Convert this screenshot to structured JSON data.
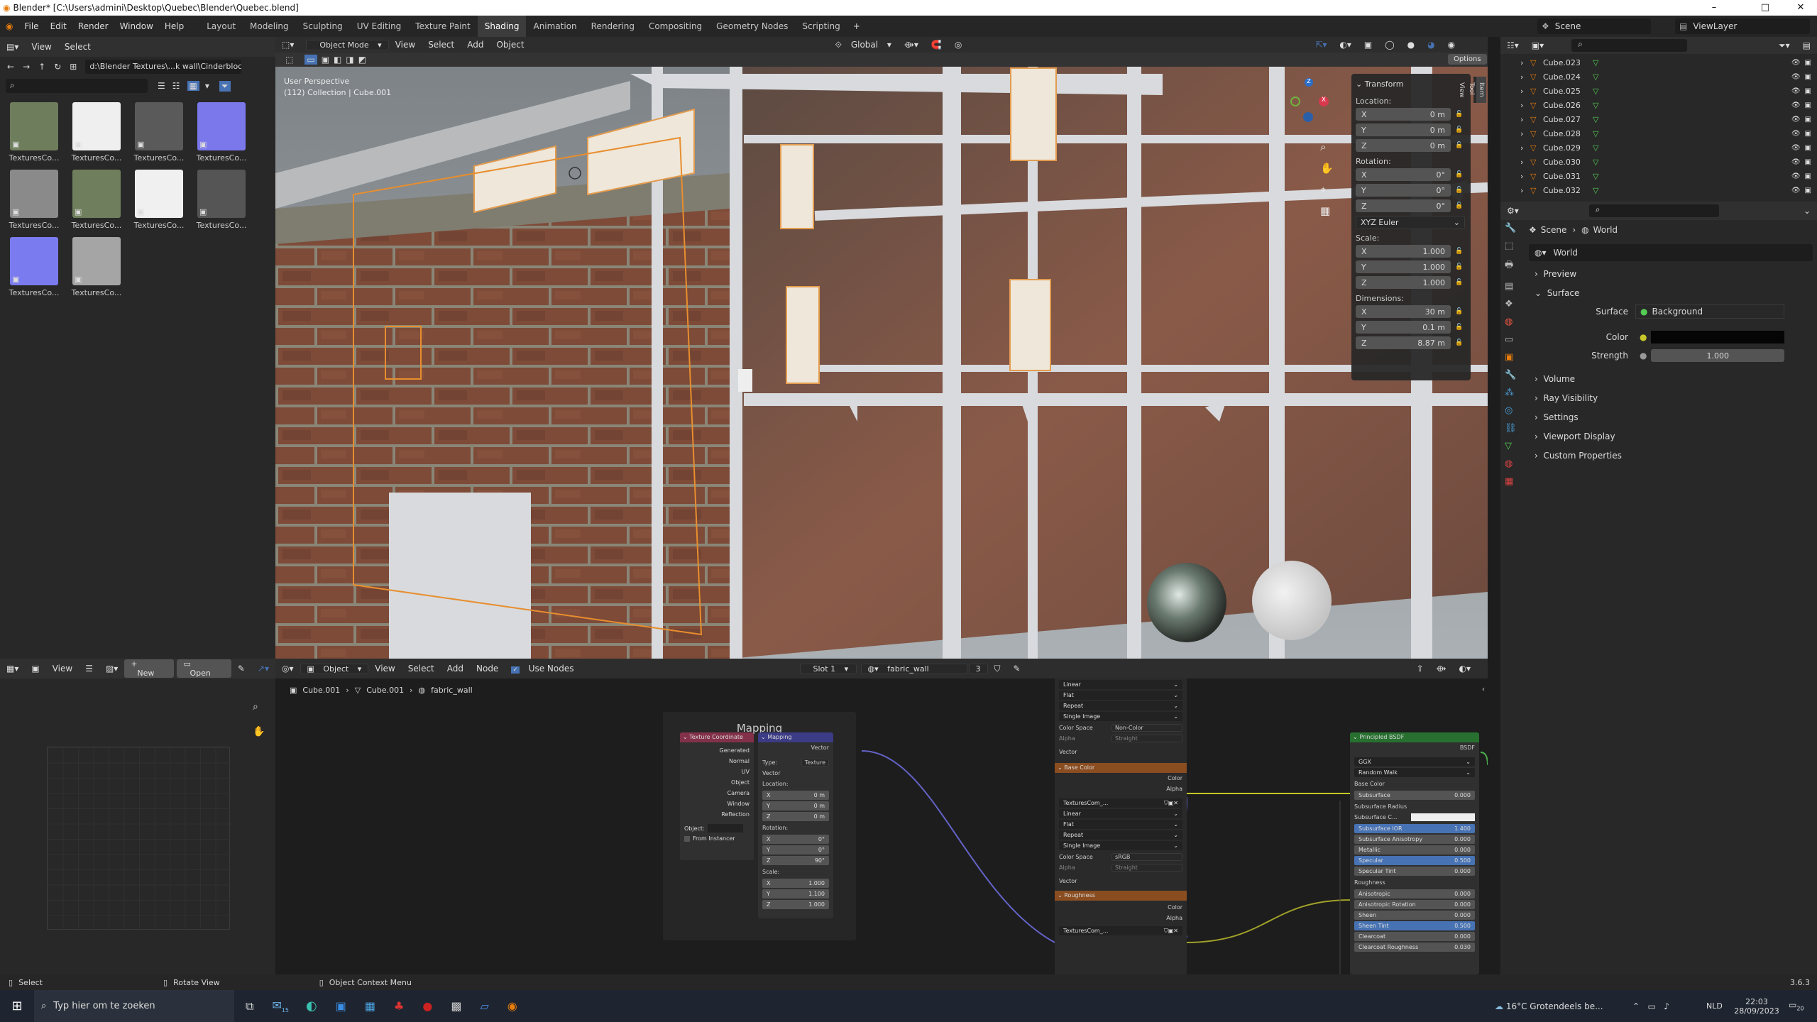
{
  "window": {
    "title": "Blender* [C:\\Users\\admini\\Desktop\\Quebec\\Blender\\Quebec.blend]",
    "minimize": "–",
    "maximize": "□",
    "close": "✕"
  },
  "menu": {
    "file": "File",
    "edit": "Edit",
    "render": "Render",
    "window": "Window",
    "help": "Help"
  },
  "workspaces": [
    "Layout",
    "Modeling",
    "Sculpting",
    "UV Editing",
    "Texture Paint",
    "Shading",
    "Animation",
    "Rendering",
    "Compositing",
    "Geometry Nodes",
    "Scripting"
  ],
  "active_workspace": "Shading",
  "scene": {
    "name": "Scene",
    "viewlayer": "ViewLayer"
  },
  "file_browser": {
    "view": "View",
    "select": "Select",
    "path": "d:\\Blender Textures\\...k wall\\Cinderblocks\\",
    "items": [
      {
        "label": "TexturesCo...",
        "color": "#6e7e5c"
      },
      {
        "label": "TexturesCo...",
        "color": "#efefef"
      },
      {
        "label": "TexturesCo...",
        "color": "#5a5a5a"
      },
      {
        "label": "TexturesCo...",
        "color": "#7b78ec"
      },
      {
        "label": "TexturesCo...",
        "color": "#8a8a8a"
      },
      {
        "label": "TexturesCo...",
        "color": "#6f7f5d"
      },
      {
        "label": "TexturesCo...",
        "color": "#f0f0f0"
      },
      {
        "label": "TexturesCo...",
        "color": "#555555"
      },
      {
        "label": "TexturesCo...",
        "color": "#7a7bee"
      },
      {
        "label": "TexturesCo...",
        "color": "#a5a5a5"
      }
    ]
  },
  "viewport": {
    "mode": "Object Mode",
    "view": "View",
    "select": "Select",
    "add": "Add",
    "object": "Object",
    "orientation": "Global",
    "options": "Options",
    "perspective": "User Perspective",
    "collection": "(112) Collection | Cube.001"
  },
  "transform": {
    "title": "Transform",
    "location_label": "Location:",
    "location": [
      {
        "axis": "X",
        "value": "0 m"
      },
      {
        "axis": "Y",
        "value": "0 m"
      },
      {
        "axis": "Z",
        "value": "0 m"
      }
    ],
    "rotation_label": "Rotation:",
    "rotation": [
      {
        "axis": "X",
        "value": "0°"
      },
      {
        "axis": "Y",
        "value": "0°"
      },
      {
        "axis": "Z",
        "value": "0°"
      }
    ],
    "euler": "XYZ Euler",
    "scale_label": "Scale:",
    "scale": [
      {
        "axis": "X",
        "value": "1.000"
      },
      {
        "axis": "Y",
        "value": "1.000"
      },
      {
        "axis": "Z",
        "value": "1.000"
      }
    ],
    "dimensions_label": "Dimensions:",
    "dimensions": [
      {
        "axis": "X",
        "value": "30 m"
      },
      {
        "axis": "Y",
        "value": "0.1 m"
      },
      {
        "axis": "Z",
        "value": "8.87 m"
      }
    ]
  },
  "side_tabs": [
    "Item",
    "Tool",
    "View"
  ],
  "outliner": {
    "items": [
      "Cube.023",
      "Cube.024",
      "Cube.025",
      "Cube.026",
      "Cube.027",
      "Cube.028",
      "Cube.029",
      "Cube.030",
      "Cube.031",
      "Cube.032"
    ]
  },
  "properties": {
    "breadcrumb_scene": "Scene",
    "breadcrumb_world": "World",
    "world": "World",
    "sections": {
      "preview": "Preview",
      "surface": "Surface",
      "volume": "Volume",
      "ray_visibility": "Ray Visibility",
      "settings": "Settings",
      "viewport_display": "Viewport Display",
      "custom_properties": "Custom Properties"
    },
    "surface_label": "Surface",
    "surface_value": "Background",
    "color_label": "Color",
    "strength_label": "Strength",
    "strength_value": "1.000"
  },
  "image_editor": {
    "view": "View",
    "new": "New",
    "open": "Open"
  },
  "node_editor": {
    "object": "Object",
    "view": "View",
    "select": "Select",
    "add": "Add",
    "node": "Node",
    "use_nodes": "Use Nodes",
    "slot": "Slot 1",
    "material": "fabric_wall",
    "users": "3",
    "breadcrumb": [
      "Cube.001",
      "Cube.001",
      "fabric_wall"
    ],
    "frame_label": "Mapping",
    "texcoord": {
      "title": "Texture Coordinate",
      "outputs": [
        "Generated",
        "Normal",
        "UV",
        "Object",
        "Camera",
        "Window",
        "Reflection"
      ],
      "object_label": "Object:",
      "from_instancer": "From Instancer"
    },
    "mapping": {
      "title": "Mapping",
      "vector_out": "Vector",
      "type_label": "Type:",
      "type_value": "Texture",
      "vector_in": "Vector",
      "location": "Location:",
      "loc": [
        "0 m",
        "0 m",
        "0 m"
      ],
      "rotation": "Rotation:",
      "rot": [
        "0°",
        "0°",
        "90°"
      ],
      "scale": "Scale:",
      "scl": [
        "1.000",
        "1.100",
        "1.000"
      ]
    },
    "img_top": {
      "interp": "Linear",
      "proj": "Flat",
      "ext": "Repeat",
      "src": "Single Image",
      "cs_label": "Color Space",
      "cs_value": "Non-Color",
      "alpha_label": "Alpha",
      "alpha_value": "Straight",
      "vector": "Vector"
    },
    "base_color": {
      "title": "Base Color",
      "color": "Color",
      "alpha": "Alpha",
      "image": "TexturesCom_...",
      "interp": "Linear",
      "proj": "Flat",
      "ext": "Repeat",
      "src": "Single Image",
      "cs_label": "Color Space",
      "cs_value": "sRGB",
      "alpha_label": "Alpha",
      "alpha_value": "Straight",
      "vector": "Vector"
    },
    "roughness": {
      "title": "Roughness",
      "color": "Color",
      "alpha": "Alpha",
      "image": "TexturesCom_..."
    },
    "bsdf": {
      "title": "Principled BSDF",
      "out": "BSDF",
      "dist": "GGX",
      "sss": "Random Walk",
      "base_color": "Base Color",
      "rows": [
        {
          "label": "Subsurface",
          "value": "0.000"
        },
        {
          "label": "Subsurface Radius",
          "value": ""
        },
        {
          "label": "Subsurface C...",
          "value": ""
        },
        {
          "label": "Subsurface IOR",
          "value": "1.400"
        },
        {
          "label": "Subsurface Anisotropy",
          "value": "0.000"
        },
        {
          "label": "Metallic",
          "value": "0.000"
        },
        {
          "label": "Specular",
          "value": "0.500"
        },
        {
          "label": "Specular Tint",
          "value": "0.000"
        },
        {
          "label": "Roughness",
          "value": ""
        },
        {
          "label": "Anisotropic",
          "value": "0.000"
        },
        {
          "label": "Anisotropic Rotation",
          "value": "0.000"
        },
        {
          "label": "Sheen",
          "value": "0.000"
        },
        {
          "label": "Sheen Tint",
          "value": "0.500"
        },
        {
          "label": "Clearcoat",
          "value": "0.000"
        },
        {
          "label": "Clearcoat Roughness",
          "value": "0.030"
        }
      ]
    }
  },
  "statusbar": {
    "select": "Select",
    "rotate": "Rotate View",
    "context": "Object Context Menu",
    "version": "3.6.3"
  },
  "taskbar": {
    "search": "Typ hier om te zoeken",
    "mail_badge": "15",
    "weather": "16°C  Grotendeels be...",
    "lang": "NLD",
    "time": "22:03",
    "date": "28/09/2023",
    "notif": "20"
  }
}
